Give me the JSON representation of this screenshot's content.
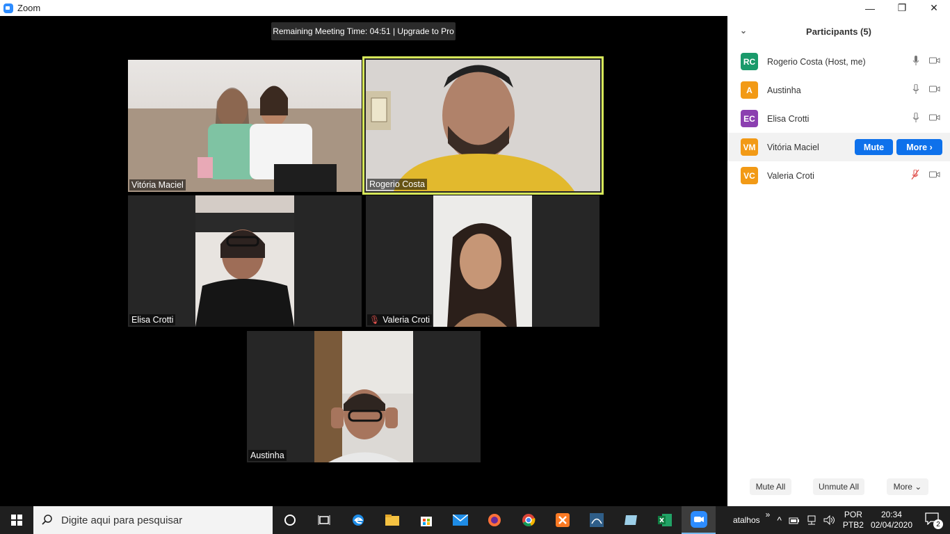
{
  "window": {
    "title": "Zoom",
    "minimize": "—",
    "maximize": "❐",
    "close": "✕"
  },
  "meeting": {
    "timer_text": "Remaining Meeting Time: 04:51 | Upgrade to Pro",
    "tiles": [
      {
        "name": "Vitória Maciel",
        "muted": false,
        "active": false
      },
      {
        "name": "Rogerio Costa",
        "muted": false,
        "active": true
      },
      {
        "name": "Elisa Crotti",
        "muted": false,
        "active": false
      },
      {
        "name": "Valeria Croti",
        "muted": true,
        "active": false
      },
      {
        "name": "Austinha",
        "muted": false,
        "active": false
      }
    ]
  },
  "participants": {
    "title": "Participants (5)",
    "list": [
      {
        "initials": "RC",
        "name": "Rogerio Costa (Host, me)",
        "color": "#1a9a6b",
        "muted": false
      },
      {
        "initials": "A",
        "name": "Austinha",
        "color": "#f29a16",
        "muted": false
      },
      {
        "initials": "EC",
        "name": "Elisa Crotti",
        "color": "#8b3fb0",
        "muted": false
      },
      {
        "initials": "VM",
        "name": "Vitória Maciel",
        "color": "#f29a16",
        "muted": false
      },
      {
        "initials": "VC",
        "name": "Valeria Croti",
        "color": "#f29a16",
        "muted": true
      }
    ],
    "mute_label": "Mute",
    "more_label": "More ›",
    "mute_all": "Mute All",
    "unmute_all": "Unmute All",
    "more_footer": "More ⌄"
  },
  "taskbar": {
    "search_placeholder": "Digite aqui para pesquisar",
    "atalhos": "atalhos",
    "chevron": "»",
    "lang_top": "POR",
    "lang_bottom": "PTB2",
    "time": "20:34",
    "date": "02/04/2020",
    "notification_count": "2"
  }
}
